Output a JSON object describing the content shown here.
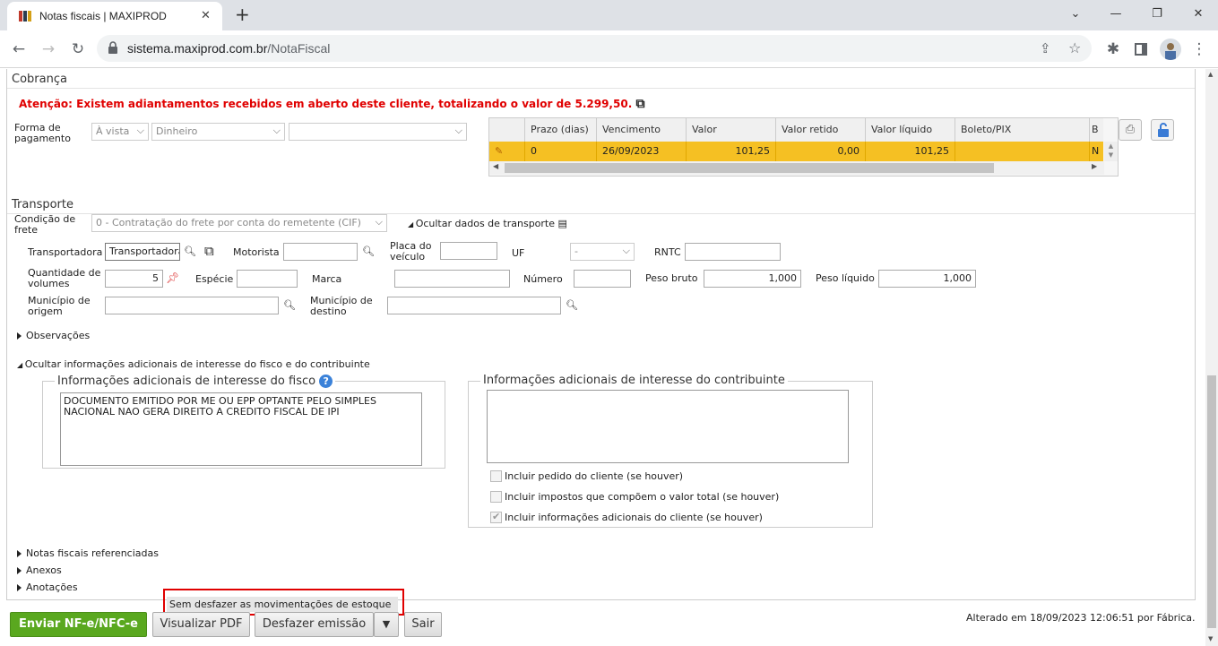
{
  "browser": {
    "tab_title": "Notas fiscais | MAXIPROD",
    "new_tab": "+",
    "minimize": "⌄",
    "window_min": "—",
    "window_restore": "❐",
    "window_close": "✕",
    "url_host": "sistema.maxiprod.com.br",
    "url_path": "/NotaFiscal"
  },
  "cobranca": {
    "title": "Cobrança",
    "warning": "Atenção: Existem adiantamentos recebidos em aberto deste cliente, totalizando o valor de 5.299,50.",
    "forma_label": "Forma de pagamento",
    "forma_label_1": "Forma de",
    "forma_label_2": "pagamento",
    "forma_tipo": "À vista",
    "forma_meio": "Dinheiro",
    "forma_extra": "",
    "grid": {
      "headers": [
        "Prazo (dias)",
        "Vencimento",
        "Valor",
        "Valor retido",
        "Valor líquido",
        "Boleto/PIX",
        "B"
      ],
      "row": [
        "0",
        "26/09/2023",
        "101,25",
        "0,00",
        "101,25",
        "",
        "N"
      ]
    }
  },
  "transporte": {
    "title": "Transporte",
    "condicao_label_1": "Condição de",
    "condicao_label_2": "frete",
    "condicao_value": "0 - Contratação do frete por conta do remetente (CIF)",
    "ocultar_dados": "Ocultar dados de transporte",
    "transportadora_label": "Transportadora",
    "transportadora_value": "Transportadora",
    "motorista_label": "Motorista",
    "motorista_value": "",
    "placa_label_1": "Placa do",
    "placa_label_2": "veículo",
    "placa_value": "",
    "uf_label": "UF",
    "uf_value": "-",
    "rntc_label": "RNTC",
    "rntc_value": "",
    "qtd_label_1": "Quantidade de",
    "qtd_label_2": "volumes",
    "qtd_value": "5",
    "especie_label": "Espécie",
    "especie_value": "",
    "marca_label": "Marca",
    "marca_value": "",
    "numero_label": "Número",
    "numero_value": "",
    "peso_bruto_label": "Peso bruto",
    "peso_bruto_value": "1,000",
    "peso_liquido_label": "Peso líquido",
    "peso_liquido_value": "1,000",
    "mun_origem_label_1": "Município de",
    "mun_origem_label_2": "origem",
    "mun_origem_value": "",
    "mun_destino_label_1": "Município de",
    "mun_destino_label_2": "destino",
    "mun_destino_value": ""
  },
  "observacoes": "Observações",
  "info_toggle": "Ocultar informações adicionais de interesse do fisco e do contribuinte",
  "info_fisco": {
    "legend": "Informações adicionais de interesse do fisco",
    "text": "DOCUMENTO EMITIDO POR ME OU EPP OPTANTE PELO SIMPLES\nNACIONAL NAO GERA DIREITO A CREDITO FISCAL DE IPI"
  },
  "info_contrib": {
    "legend": "Informações adicionais de interesse do contribuinte",
    "text": "",
    "chk1": "Incluir pedido do cliente (se houver)",
    "chk2": "Incluir impostos que compõem o valor total (se houver)",
    "chk3": "Incluir informações adicionais do cliente (se houver)",
    "chk1_checked": false,
    "chk2_checked": false,
    "chk3_checked": true
  },
  "links": {
    "notas_ref": "Notas fiscais referenciadas",
    "anexos": "Anexos",
    "anotacoes": "Anotações"
  },
  "dropdown_item": "Sem desfazer as movimentações de estoque",
  "footer": {
    "enviar": "Enviar NF-e/NFC-e",
    "visualizar": "Visualizar PDF",
    "desfazer": "Desfazer emissão",
    "sair": "Sair",
    "alterado": "Alterado em 18/09/2023 12:06:51 por Fábrica."
  },
  "colors": {
    "accent_green": "#5aa81f",
    "warning_red": "#e00000",
    "grid_row": "#f5c023",
    "highlight_box": "#e00000"
  }
}
